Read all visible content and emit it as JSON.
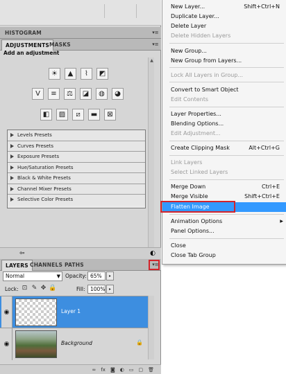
{
  "histogram_tab": "HISTOGRAM",
  "adjustments_panel": {
    "tabs": [
      "ADJUSTMENTS",
      "MASKS"
    ],
    "header": "Add an adjustment",
    "icon_rows": [
      [
        "brightness-contrast-icon",
        "levels-icon",
        "curves-icon",
        "exposure-icon"
      ],
      [
        "vibrance-icon",
        "hue-saturation-icon",
        "color-balance-icon",
        "black-white-icon",
        "photo-filter-icon",
        "channel-mixer-icon"
      ],
      [
        "invert-icon",
        "posterize-icon",
        "threshold-icon",
        "gradient-map-icon",
        "selective-color-icon"
      ]
    ],
    "presets": [
      "Levels Presets",
      "Curves Presets",
      "Exposure Presets",
      "Hue/Saturation Presets",
      "Black & White Presets",
      "Channel Mixer Presets",
      "Selective Color Presets"
    ]
  },
  "layers_panel": {
    "tabs": [
      "LAYERS",
      "CHANNELS",
      "PATHS"
    ],
    "blend_mode": "Normal",
    "opacity_label": "Opacity:",
    "opacity_value": "65%",
    "lock_label": "Lock:",
    "fill_label": "Fill:",
    "fill_value": "100%",
    "layers": [
      {
        "name": "Layer 1",
        "selected": true
      },
      {
        "name": "Background",
        "selected": false
      }
    ]
  },
  "context_menu": {
    "highlight_color": "#3399ff",
    "items": [
      {
        "label": "New Layer...",
        "shortcut": "Shift+Ctrl+N",
        "disabled": false
      },
      {
        "label": "Duplicate Layer...",
        "shortcut": "",
        "disabled": false
      },
      {
        "label": "Delete Layer",
        "shortcut": "",
        "disabled": false
      },
      {
        "label": "Delete Hidden Layers",
        "shortcut": "",
        "disabled": true
      },
      {
        "label": "New Group...",
        "shortcut": "",
        "disabled": false
      },
      {
        "label": "New Group from Layers...",
        "shortcut": "",
        "disabled": false
      },
      {
        "label": "Lock All Layers in Group...",
        "shortcut": "",
        "disabled": true
      },
      {
        "label": "Convert to Smart Object",
        "shortcut": "",
        "disabled": false
      },
      {
        "label": "Edit Contents",
        "shortcut": "",
        "disabled": true
      },
      {
        "label": "Layer Properties...",
        "shortcut": "",
        "disabled": false
      },
      {
        "label": "Blending Options...",
        "shortcut": "",
        "disabled": false
      },
      {
        "label": "Edit Adjustment...",
        "shortcut": "",
        "disabled": true
      },
      {
        "label": "Create Clipping Mask",
        "shortcut": "Alt+Ctrl+G",
        "disabled": false
      },
      {
        "label": "Link Layers",
        "shortcut": "",
        "disabled": true
      },
      {
        "label": "Select Linked Layers",
        "shortcut": "",
        "disabled": true
      },
      {
        "label": "Merge Down",
        "shortcut": "Ctrl+E",
        "disabled": false
      },
      {
        "label": "Merge Visible",
        "shortcut": "Shift+Ctrl+E",
        "disabled": false
      },
      {
        "label": "Flatten Image",
        "shortcut": "",
        "disabled": false,
        "highlighted": true
      },
      {
        "label": "Animation Options",
        "shortcut": "",
        "disabled": false,
        "submenu": true
      },
      {
        "label": "Panel Options...",
        "shortcut": "",
        "disabled": false
      },
      {
        "label": "Close",
        "shortcut": "",
        "disabled": false
      },
      {
        "label": "Close Tab Group",
        "shortcut": "",
        "disabled": false
      }
    ]
  }
}
